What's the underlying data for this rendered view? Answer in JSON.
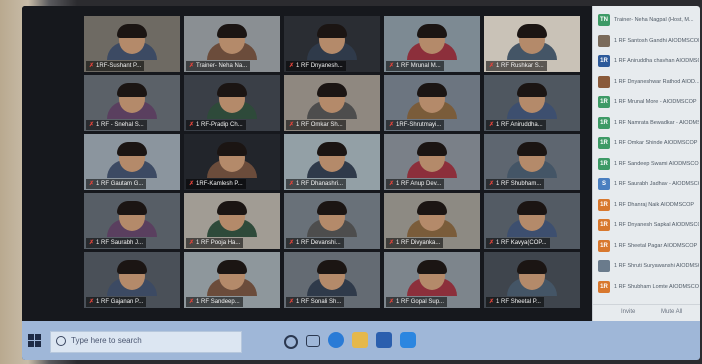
{
  "gallery": {
    "tiles": [
      {
        "label": "1RF-Sushant P..."
      },
      {
        "label": "Trainer- Neha Na..."
      },
      {
        "label": "1 RF Dnyanesh..."
      },
      {
        "label": "1 RF Mrunal M..."
      },
      {
        "label": "1 RF Rushkar S..."
      },
      {
        "label": "1 RF - Snehal S..."
      },
      {
        "label": "1 RF-Pradip Ch..."
      },
      {
        "label": "1 RF Omkar Sh..."
      },
      {
        "label": "1RF-Shrutmayi..."
      },
      {
        "label": "1 RF Aniruddha..."
      },
      {
        "label": "1 RF Gautam G..."
      },
      {
        "label": "1RF-Kamlesh P..."
      },
      {
        "label": "1 RF Dhanashri..."
      },
      {
        "label": "1 RF Anup Dev..."
      },
      {
        "label": "1 RF Shubham..."
      },
      {
        "label": "1 RF Saurabh J..."
      },
      {
        "label": "1 RF Pooja Ha..."
      },
      {
        "label": "1 RF Devanshi..."
      },
      {
        "label": "1 RF Divyanka..."
      },
      {
        "label": "1 RF Kavya(COP..."
      },
      {
        "label": "1 RF Gajanan P..."
      },
      {
        "label": "1 RF Sandeep..."
      },
      {
        "label": "1 RF Sonali Sh..."
      },
      {
        "label": "1 RF Gopal Sup..."
      },
      {
        "label": "1 RF Sheetal P..."
      }
    ]
  },
  "participants": {
    "items": [
      {
        "initials": "TN",
        "name": "Trainer- Neha Nagpal (Host, M...",
        "color": "#3d9a66"
      },
      {
        "initials": "",
        "name": "1 RF Santosh Gandhi AIODMSCOP",
        "color": "#7a6a5a"
      },
      {
        "initials": "1R",
        "name": "1 RF Aniruddha chavhan AIODMSCOP",
        "color": "#2d5a9a"
      },
      {
        "initials": "",
        "name": "1 RF Dnyaneshwar Rathod AIOD...",
        "color": "#8a5a3a"
      },
      {
        "initials": "1R",
        "name": "1 RF Mrunal More - AIODMSCOP",
        "color": "#3d9a66"
      },
      {
        "initials": "1R",
        "name": "1 RF Namrata Bewadkar - AIODMS...",
        "color": "#3d9a66"
      },
      {
        "initials": "1R",
        "name": "1 RF Omkar Shinde AIODMSCOP",
        "color": "#3d9a66"
      },
      {
        "initials": "1R",
        "name": "1 RF Sandeep Swami AIODMSCOP",
        "color": "#3d9a66"
      },
      {
        "initials": "S",
        "name": "1 RF Saurabh Jadhav - AIODMSCOP",
        "color": "#4a7fc0"
      },
      {
        "initials": "1R",
        "name": "1 RF Dhanraj Naik AIODMSCOP",
        "color": "#d8782e"
      },
      {
        "initials": "1R",
        "name": "1 RF Dnyanesh Sapkal AIODMSCOP",
        "color": "#d8782e"
      },
      {
        "initials": "1R",
        "name": "1 RF Sheetal Pagar AIODMSCOP",
        "color": "#d8782e"
      },
      {
        "initials": "",
        "name": "1 RF Shruti Suryawanshi AIODMSC...",
        "color": "#6a7b8c"
      },
      {
        "initials": "1R",
        "name": "1 RF Shubham Lomte AIODMSCOP",
        "color": "#d8782e"
      }
    ],
    "footer": {
      "left": "Invite",
      "right": "Mute All"
    }
  },
  "taskbar": {
    "search_placeholder": "Type here to search"
  }
}
